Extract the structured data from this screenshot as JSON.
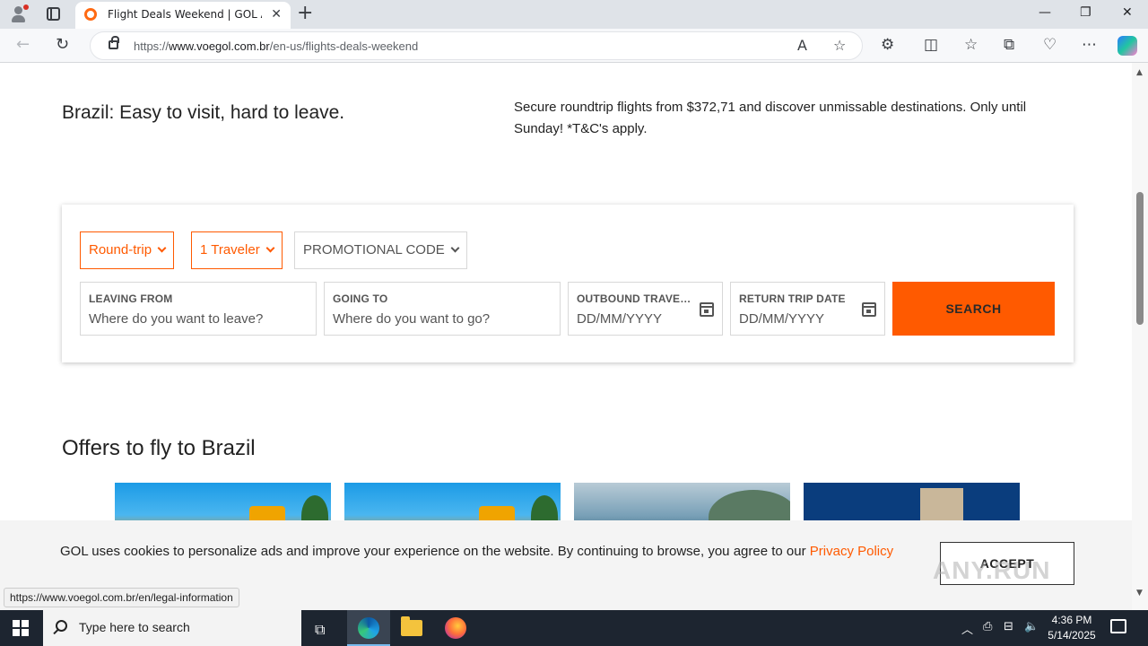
{
  "browser": {
    "tab_title": "Flight Deals Weekend | GOL Airlines",
    "new_tab": "+",
    "url_prefix": "https://",
    "url_domain": "www.voegol.com.br",
    "url_path": "/en-us/flights-deals-weekend",
    "window_controls": {
      "minimize": "—",
      "restore": "❐",
      "close": "✕"
    }
  },
  "hero": {
    "title": "Brazil: Easy to visit, hard to leave.",
    "description": "Secure roundtrip flights from $372,71 and discover unmissable destinations. Only until Sunday! *T&C's apply."
  },
  "search": {
    "trip_type": "Round-trip",
    "travelers": "1 Traveler",
    "promo_code": "PROMOTIONAL CODE",
    "leaving_label": "LEAVING FROM",
    "leaving_placeholder": "Where do you want to leave?",
    "going_label": "GOING TO",
    "going_placeholder": "Where do you want to go?",
    "outbound_label": "OUTBOUND TRAVEL DATE",
    "outbound_placeholder": "DD/MM/YYYY",
    "return_label": "RETURN TRIP DATE",
    "return_placeholder": "DD/MM/YYYY",
    "search_button": "SEARCH"
  },
  "offers": {
    "title": "Offers to fly to Brazil"
  },
  "cookie": {
    "text": "GOL uses cookies to personalize ads and improve your experience on the website. By continuing to browse, you agree to our ",
    "link": "Privacy Policy",
    "accept": "ACCEPT"
  },
  "status_bar_url": "https://www.voegol.com.br/en/legal-information",
  "watermark": "ANY.RUN",
  "taskbar": {
    "search_placeholder": "Type here to search",
    "time": "4:36 PM",
    "date": "5/14/2025"
  },
  "colors": {
    "brand_orange": "#ff5a00",
    "taskbar": "#1d2530"
  }
}
